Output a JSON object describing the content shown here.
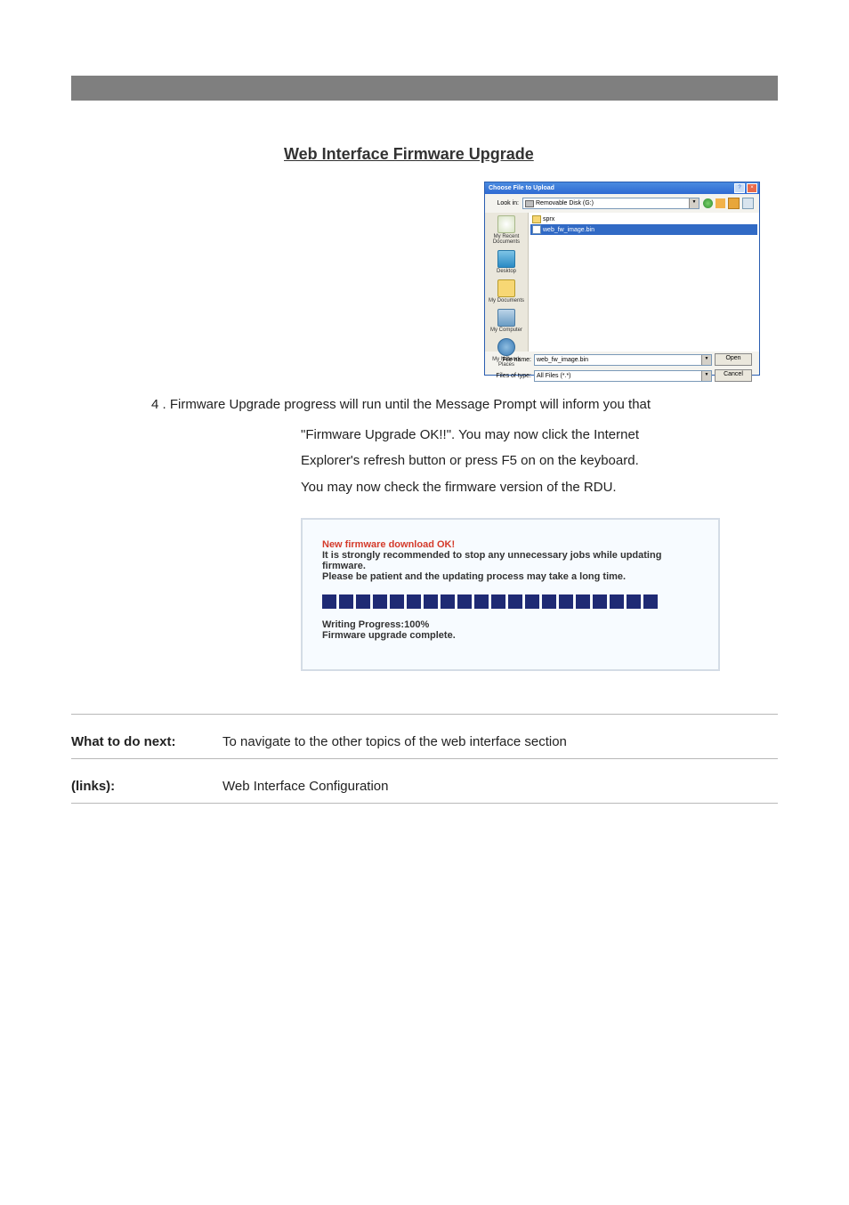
{
  "section_title": "Web Interface Firmware Upgrade",
  "file_dialog": {
    "title": "Choose File to Upload",
    "look_in_label": "Look in:",
    "look_in_value": "Removable Disk (G:)",
    "places": {
      "recent": "My Recent Documents",
      "desktop": "Desktop",
      "mydocs": "My Documents",
      "mycomp": "My Computer",
      "network": "My Network Places"
    },
    "files": {
      "folder": "sprx",
      "selected": "web_fw_image.bin"
    },
    "file_name_label": "File name:",
    "file_name_value": "web_fw_image.bin",
    "files_of_type_label": "Files of type:",
    "files_of_type_value": "All Files (*.*)",
    "open_btn": "Open",
    "cancel_btn": "Cancel",
    "nav_icons": {
      "back": "back-icon",
      "up": "up-one-level-icon",
      "new": "new-folder-icon",
      "views": "views-icon"
    }
  },
  "step4_pre": "4 . Firmware Upgrade progress will run until the Message Prompt will inform you that",
  "step4_quote": "\"Firmware Upgrade OK!!\". You may now click the Internet",
  "step4_post1": "Explorer's refresh button or press F5 on on the keyboard.",
  "step4_post2": "You may now check the firmware version of the RDU.",
  "progress_box": {
    "line1": "New firmware download OK!",
    "line2": "It is strongly recommended to stop any unnecessary jobs while updating firmware.",
    "line3": "Please be patient and the updating process may take a long time.",
    "line4": "Writing Progress:100%",
    "line5": "Firmware upgrade complete."
  },
  "footer": {
    "what_to_do": "What to do next:",
    "what_to_do_desc": "To navigate to the other topics of the web interface section",
    "link_label": "(links):",
    "link_desc": "Web Interface Configuration"
  }
}
